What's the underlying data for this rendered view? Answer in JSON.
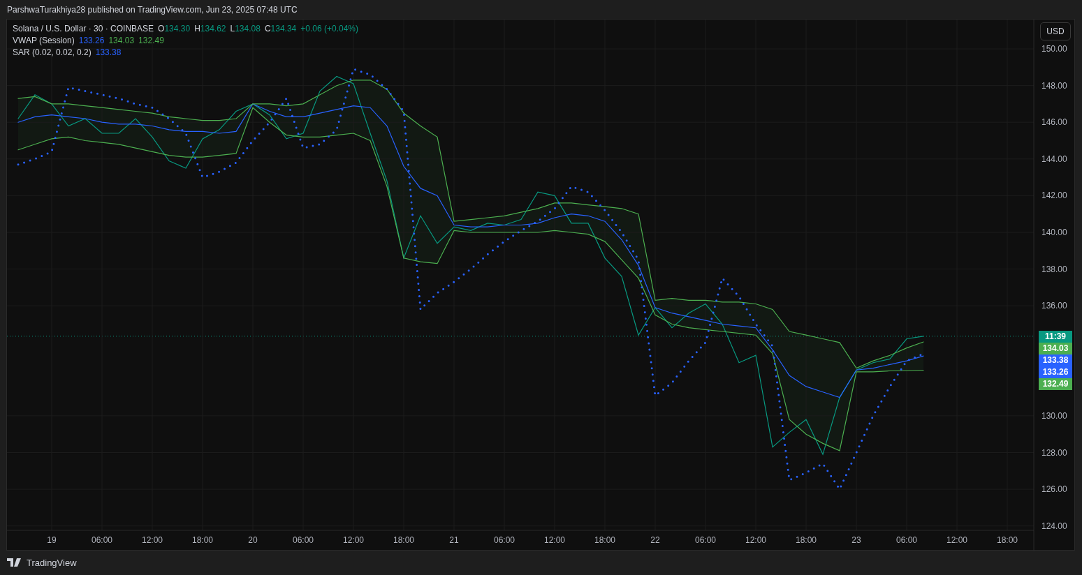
{
  "header": {
    "text": "ParshwaTurakhiya28 published on TradingView.com, Jun 23, 2025 07:48 UTC"
  },
  "legend": {
    "symbol": "Solana / U.S. Dollar · 30 · COINBASE",
    "ohlc": [
      {
        "label": "O",
        "value": "134.30"
      },
      {
        "label": "H",
        "value": "134.62"
      },
      {
        "label": "L",
        "value": "134.08"
      },
      {
        "label": "C",
        "value": "134.34"
      }
    ],
    "change": "+0.06 (+0.04%)",
    "indicators": [
      {
        "name": "VWAP (Session)",
        "values": [
          {
            "text": "133.26",
            "color": "#2962ff"
          },
          {
            "text": "134.03",
            "color": "#4caf50"
          },
          {
            "text": "132.49",
            "color": "#4caf50"
          }
        ]
      },
      {
        "name": "SAR (0.02, 0.02, 0.2)",
        "values": [
          {
            "text": "133.38",
            "color": "#2962ff"
          }
        ]
      }
    ]
  },
  "currency_button": "USD",
  "price_tags": [
    {
      "text": "11:39",
      "color": "#089981"
    },
    {
      "text": "134.03",
      "color": "#4caf50"
    },
    {
      "text": "133.38",
      "color": "#2962ff"
    },
    {
      "text": "133.26",
      "color": "#2962ff"
    },
    {
      "text": "132.49",
      "color": "#4caf50"
    }
  ],
  "chart": {
    "chart_data": {
      "type": "line",
      "grid": true,
      "xlim": [
        "2025-06-18T18:40",
        "2025-06-23T21:10"
      ],
      "ylim": [
        123.76,
        151.6
      ],
      "x": [
        "2025-06-18T20:00",
        "2025-06-18T22:00",
        "2025-06-19T00:00",
        "2025-06-19T02:00",
        "2025-06-19T04:00",
        "2025-06-19T06:00",
        "2025-06-19T08:00",
        "2025-06-19T10:00",
        "2025-06-19T12:00",
        "2025-06-19T14:00",
        "2025-06-19T16:00",
        "2025-06-19T18:00",
        "2025-06-19T20:00",
        "2025-06-19T22:00",
        "2025-06-20T00:00",
        "2025-06-20T02:00",
        "2025-06-20T04:00",
        "2025-06-20T06:00",
        "2025-06-20T08:00",
        "2025-06-20T10:00",
        "2025-06-20T12:00",
        "2025-06-20T14:00",
        "2025-06-20T16:00",
        "2025-06-20T18:00",
        "2025-06-20T20:00",
        "2025-06-20T22:00",
        "2025-06-21T00:00",
        "2025-06-21T02:00",
        "2025-06-21T04:00",
        "2025-06-21T06:00",
        "2025-06-21T08:00",
        "2025-06-21T10:00",
        "2025-06-21T12:00",
        "2025-06-21T14:00",
        "2025-06-21T16:00",
        "2025-06-21T18:00",
        "2025-06-21T20:00",
        "2025-06-21T22:00",
        "2025-06-22T00:00",
        "2025-06-22T02:00",
        "2025-06-22T04:00",
        "2025-06-22T06:00",
        "2025-06-22T08:00",
        "2025-06-22T10:00",
        "2025-06-22T12:00",
        "2025-06-22T14:00",
        "2025-06-22T16:00",
        "2025-06-22T18:00",
        "2025-06-22T20:00",
        "2025-06-22T22:00",
        "2025-06-23T00:00",
        "2025-06-23T02:00",
        "2025-06-23T04:00",
        "2025-06-23T06:00",
        "2025-06-23T08:00"
      ],
      "xticks": [
        {
          "value": "2025-06-19T00:00",
          "label": "19"
        },
        {
          "value": "2025-06-19T06:00",
          "label": "06:00"
        },
        {
          "value": "2025-06-19T12:00",
          "label": "12:00"
        },
        {
          "value": "2025-06-19T18:00",
          "label": "18:00"
        },
        {
          "value": "2025-06-20T00:00",
          "label": "20"
        },
        {
          "value": "2025-06-20T06:00",
          "label": "06:00"
        },
        {
          "value": "2025-06-20T12:00",
          "label": "12:00"
        },
        {
          "value": "2025-06-20T18:00",
          "label": "18:00"
        },
        {
          "value": "2025-06-21T00:00",
          "label": "21"
        },
        {
          "value": "2025-06-21T06:00",
          "label": "06:00"
        },
        {
          "value": "2025-06-21T12:00",
          "label": "12:00"
        },
        {
          "value": "2025-06-21T18:00",
          "label": "18:00"
        },
        {
          "value": "2025-06-22T00:00",
          "label": "22"
        },
        {
          "value": "2025-06-22T06:00",
          "label": "06:00"
        },
        {
          "value": "2025-06-22T12:00",
          "label": "12:00"
        },
        {
          "value": "2025-06-22T18:00",
          "label": "18:00"
        },
        {
          "value": "2025-06-23T00:00",
          "label": "23"
        },
        {
          "value": "2025-06-23T06:00",
          "label": "06:00"
        },
        {
          "value": "2025-06-23T12:00",
          "label": "12:00"
        },
        {
          "value": "2025-06-23T18:00",
          "label": "18:00"
        }
      ],
      "yticks": [
        {
          "value": 150,
          "label": "150.00"
        },
        {
          "value": 148,
          "label": "148.00"
        },
        {
          "value": 146,
          "label": "146.00"
        },
        {
          "value": 144,
          "label": "144.00"
        },
        {
          "value": 142,
          "label": "142.00"
        },
        {
          "value": 140,
          "label": "140.00"
        },
        {
          "value": 138,
          "label": "138.00"
        },
        {
          "value": 136,
          "label": "136.00"
        },
        {
          "value": 130,
          "label": "130.00"
        },
        {
          "value": 128,
          "label": "128.00"
        },
        {
          "value": 126,
          "label": "126.00"
        },
        {
          "value": 124,
          "label": "124.00"
        }
      ],
      "series": [
        {
          "color": "#089981",
          "line_style": "solid",
          "values": [
            146.2,
            147.5,
            147.0,
            145.8,
            146.2,
            145.4,
            145.4,
            146.2,
            145.2,
            143.9,
            143.5,
            145.1,
            145.6,
            146.6,
            147.0,
            146.4,
            145.1,
            145.4,
            147.7,
            148.5,
            148.1,
            145.4,
            142.8,
            138.6,
            140.9,
            139.4,
            140.3,
            140.1,
            140.5,
            140.4,
            140.7,
            142.2,
            142.0,
            140.5,
            140.5,
            138.6,
            137.6,
            134.4,
            135.9,
            134.8,
            135.6,
            136.1,
            135.0,
            132.9,
            133.3,
            128.3,
            129.1,
            129.8,
            127.9,
            131.0,
            132.5,
            132.9,
            133.1,
            134.2,
            134.34
          ]
        },
        {
          "color": "#2962ff",
          "line_style": "solid",
          "values": [
            146.0,
            146.3,
            146.4,
            146.3,
            146.2,
            146.0,
            145.9,
            145.9,
            145.8,
            145.6,
            145.5,
            145.5,
            145.4,
            145.5,
            147.0,
            146.6,
            146.3,
            146.3,
            146.5,
            146.7,
            146.9,
            146.8,
            145.8,
            143.6,
            142.4,
            142.0,
            140.4,
            140.3,
            140.3,
            140.4,
            140.4,
            140.5,
            140.8,
            141.0,
            140.9,
            140.6,
            139.6,
            138.2,
            135.9,
            135.6,
            135.4,
            135.2,
            135.0,
            134.9,
            134.8,
            133.6,
            132.2,
            131.6,
            131.3,
            131.0,
            132.5,
            132.6,
            132.8,
            133.0,
            133.26
          ]
        },
        {
          "color": "#4caf50",
          "line_style": "solid",
          "values": [
            147.3,
            147.4,
            147.0,
            147.0,
            146.9,
            146.8,
            146.7,
            146.6,
            146.5,
            146.3,
            146.2,
            146.1,
            146.1,
            146.2,
            147.0,
            147.0,
            146.9,
            147.0,
            147.5,
            148.0,
            148.3,
            148.3,
            147.8,
            146.5,
            145.8,
            145.2,
            140.6,
            140.7,
            140.8,
            140.9,
            141.1,
            141.3,
            141.6,
            141.6,
            141.5,
            141.4,
            141.3,
            141.0,
            136.3,
            136.4,
            136.3,
            136.3,
            136.2,
            136.2,
            136.1,
            135.8,
            134.6,
            134.4,
            134.2,
            134.0,
            132.6,
            133.0,
            133.3,
            133.7,
            134.03
          ]
        },
        {
          "color": "#4caf50",
          "line_style": "solid",
          "values": [
            144.5,
            144.8,
            145.1,
            145.2,
            145.0,
            144.9,
            144.8,
            144.6,
            144.4,
            144.2,
            144.1,
            144.1,
            144.2,
            144.3,
            146.8,
            146.0,
            145.3,
            145.2,
            145.2,
            145.3,
            145.4,
            145.0,
            142.5,
            138.6,
            138.4,
            138.3,
            140.1,
            140.0,
            140.0,
            140.0,
            140.0,
            140.0,
            140.1,
            140.0,
            139.9,
            139.5,
            138.5,
            137.5,
            135.5,
            135.0,
            134.8,
            134.7,
            134.6,
            134.5,
            134.4,
            133.4,
            129.8,
            129.0,
            128.5,
            128.1,
            132.4,
            132.4,
            132.45,
            132.47,
            132.49
          ]
        },
        {
          "color": "#2962ff",
          "line_style": "dotted",
          "values": [
            143.7,
            144.0,
            144.4,
            147.9,
            147.7,
            147.5,
            147.3,
            147.0,
            146.8,
            146.2,
            145.4,
            143.0,
            143.3,
            143.8,
            145.0,
            146.0,
            147.3,
            144.6,
            144.8,
            145.6,
            148.9,
            148.6,
            147.8,
            146.6,
            135.8,
            136.7,
            137.3,
            138.0,
            138.8,
            139.5,
            140.1,
            140.6,
            141.3,
            142.5,
            142.2,
            141.2,
            140.0,
            138.5,
            131.1,
            131.8,
            133.0,
            134.0,
            137.5,
            136.5,
            135.0,
            133.8,
            126.5,
            126.9,
            127.4,
            126.0,
            128.0,
            130.0,
            131.6,
            133.0,
            133.38
          ]
        }
      ]
    }
  },
  "footer": {
    "brand": "TradingView"
  }
}
